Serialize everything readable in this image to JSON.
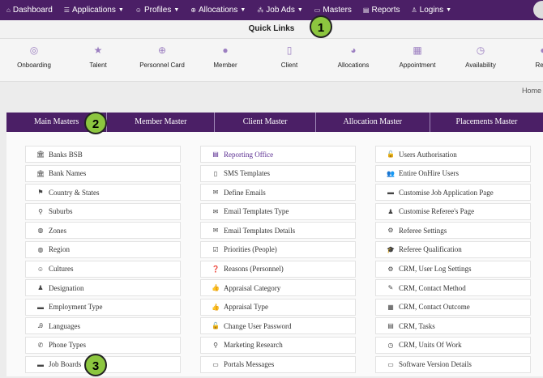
{
  "topnav": {
    "items": [
      {
        "label": "Dashboard",
        "icon": "⌂",
        "caret": ""
      },
      {
        "label": "Applications",
        "icon": "☰",
        "caret": "▼"
      },
      {
        "label": "Profiles",
        "icon": "☺",
        "caret": "▼"
      },
      {
        "label": "Allocations",
        "icon": "⊕",
        "caret": "▼"
      },
      {
        "label": "Job Ads",
        "icon": "⁂",
        "caret": "▼"
      },
      {
        "label": "Masters",
        "icon": "▭",
        "caret": ""
      },
      {
        "label": "Reports",
        "icon": "▤",
        "caret": ""
      },
      {
        "label": "Logins",
        "icon": "♙",
        "caret": "▼"
      }
    ]
  },
  "quick_links": {
    "title": "Quick Links",
    "items": [
      {
        "label": "Onboarding",
        "icon": "◎"
      },
      {
        "label": "Talent",
        "icon": "★"
      },
      {
        "label": "Personnel Card",
        "icon": "⊕"
      },
      {
        "label": "Member",
        "icon": "●"
      },
      {
        "label": "Client",
        "icon": "▯"
      },
      {
        "label": "Allocations",
        "icon": "◕"
      },
      {
        "label": "Appointment",
        "icon": "▦"
      },
      {
        "label": "Availability",
        "icon": "◷"
      },
      {
        "label": "Restr",
        "icon": "●"
      }
    ]
  },
  "breadcrumb": {
    "home": "Home"
  },
  "tabs": [
    "Main Masters",
    "Member Master",
    "Client Master",
    "Allocation Master",
    "Placements Master"
  ],
  "columns": [
    [
      {
        "label": "Banks BSB",
        "icon": "🏛"
      },
      {
        "label": "Bank Names",
        "icon": "🏛"
      },
      {
        "label": "Country & States",
        "icon": "⚑"
      },
      {
        "label": "Suburbs",
        "icon": "⚲"
      },
      {
        "label": "Zones",
        "icon": "◍"
      },
      {
        "label": "Region",
        "icon": "◍"
      },
      {
        "label": "Cultures",
        "icon": "☺"
      },
      {
        "label": "Designation",
        "icon": "♟"
      },
      {
        "label": "Employment Type",
        "icon": "▬"
      },
      {
        "label": "Languages",
        "icon": "Ꭿ"
      },
      {
        "label": "Phone Types",
        "icon": "✆"
      },
      {
        "label": "Job Boards",
        "icon": "▬"
      }
    ],
    [
      {
        "label": "Reporting Office",
        "icon": "▤"
      },
      {
        "label": "SMS Templates",
        "icon": "▯"
      },
      {
        "label": "Define Emails",
        "icon": "✉"
      },
      {
        "label": "Email Templates Type",
        "icon": "✉"
      },
      {
        "label": "Email Templates Details",
        "icon": "✉"
      },
      {
        "label": "Priorities (People)",
        "icon": "☑"
      },
      {
        "label": "Reasons (Personnel)",
        "icon": "❓"
      },
      {
        "label": "Appraisal Category",
        "icon": "👍"
      },
      {
        "label": "Appraisal Type",
        "icon": "👍"
      },
      {
        "label": "Change User Password",
        "icon": "🔓"
      },
      {
        "label": "Marketing Research",
        "icon": "⚲"
      },
      {
        "label": "Portals Messages",
        "icon": "▭"
      }
    ],
    [
      {
        "label": "Users Authorisation",
        "icon": "🔓"
      },
      {
        "label": "Entire OnHire Users",
        "icon": "👥"
      },
      {
        "label": "Customise Job Application Page",
        "icon": "▬"
      },
      {
        "label": "Customise Referee's Page",
        "icon": "♟"
      },
      {
        "label": "Referee Settings",
        "icon": "⚙"
      },
      {
        "label": "Referee Qualification",
        "icon": "🎓"
      },
      {
        "label": "CRM, User Log Settings",
        "icon": "⚙"
      },
      {
        "label": "CRM, Contact Method",
        "icon": "✎"
      },
      {
        "label": "CRM, Contact Outcome",
        "icon": "▦"
      },
      {
        "label": "CRM, Tasks",
        "icon": "▤"
      },
      {
        "label": "CRM, Units Of Work",
        "icon": "◷"
      },
      {
        "label": "Software Version Details",
        "icon": "▭"
      }
    ]
  ],
  "badges": [
    "1",
    "2",
    "3"
  ]
}
